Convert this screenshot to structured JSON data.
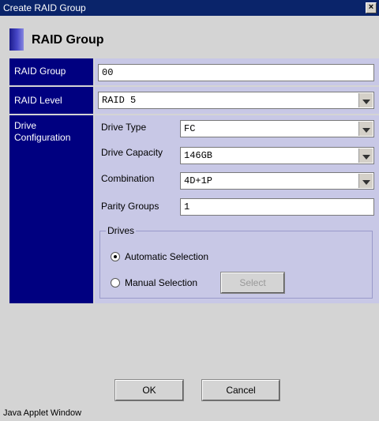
{
  "window": {
    "title": "Create RAID Group",
    "close_glyph": "×",
    "footer": "Java Applet Window"
  },
  "header": {
    "title": "RAID Group"
  },
  "form": {
    "raid_group": {
      "label": "RAID Group",
      "value": "00"
    },
    "raid_level": {
      "label": "RAID Level",
      "value": "RAID 5"
    },
    "drive_configuration": {
      "label_line1": "Drive",
      "label_line2": "Configuration",
      "drive_type": {
        "label": "Drive Type",
        "value": "FC"
      },
      "drive_capacity": {
        "label": "Drive Capacity",
        "value": "146GB"
      },
      "combination": {
        "label": "Combination",
        "value": "4D+1P"
      },
      "parity_groups": {
        "label": "Parity Groups",
        "value": "1"
      },
      "drives": {
        "legend": "Drives",
        "automatic": {
          "label": "Automatic Selection",
          "checked": true
        },
        "manual": {
          "label": "Manual Selection",
          "checked": false
        },
        "select_button": "Select"
      }
    }
  },
  "buttons": {
    "ok": "OK",
    "cancel": "Cancel"
  }
}
